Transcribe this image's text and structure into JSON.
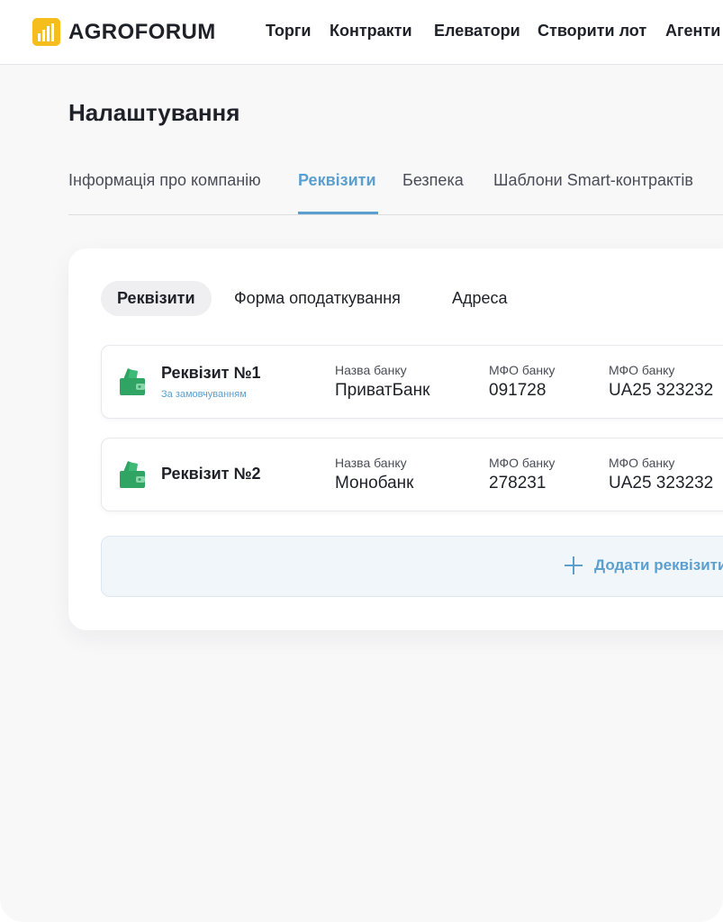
{
  "brand": {
    "name": "AGROFORUM",
    "color": "#f5be1d",
    "logo_icon": "grain-bars-icon"
  },
  "nav": [
    "Торги",
    "Контракти",
    "Елеватори",
    "Створити лот",
    "Агенти"
  ],
  "page_title": "Налаштування",
  "tabs": [
    {
      "label": "Інформація про компанію",
      "active": false
    },
    {
      "label": "Реквізити",
      "active": true
    },
    {
      "label": "Безпека",
      "active": false
    },
    {
      "label": "Шаблони Smart-контрактів",
      "active": false
    }
  ],
  "subtabs": [
    {
      "label": "Реквізити",
      "active": true
    },
    {
      "label": "Форма оподаткування",
      "active": false
    },
    {
      "label": "Адреса",
      "active": false
    }
  ],
  "requisites": [
    {
      "title": "Реквізит №1",
      "badge": "За замовчуванням",
      "icon": "wallet-icon",
      "fields": [
        {
          "label": "Назва банку",
          "value": "ПриватБанк"
        },
        {
          "label": "МФО банку",
          "value": "091728"
        },
        {
          "label": "МФО банку",
          "value": "UA25 323232"
        }
      ]
    },
    {
      "title": "Реквізит №2",
      "badge": "",
      "icon": "wallet-icon",
      "fields": [
        {
          "label": "Назва банку",
          "value": "Монобанк"
        },
        {
          "label": "МФО банку",
          "value": "278231"
        },
        {
          "label": "МФО банку",
          "value": "UA25 323232"
        }
      ]
    }
  ],
  "add_button": {
    "label": "Додати реквізити",
    "icon": "plus-icon"
  },
  "colors": {
    "accent": "#5b9fcf",
    "wallet": "#2fa463",
    "text": "#1f2128"
  }
}
